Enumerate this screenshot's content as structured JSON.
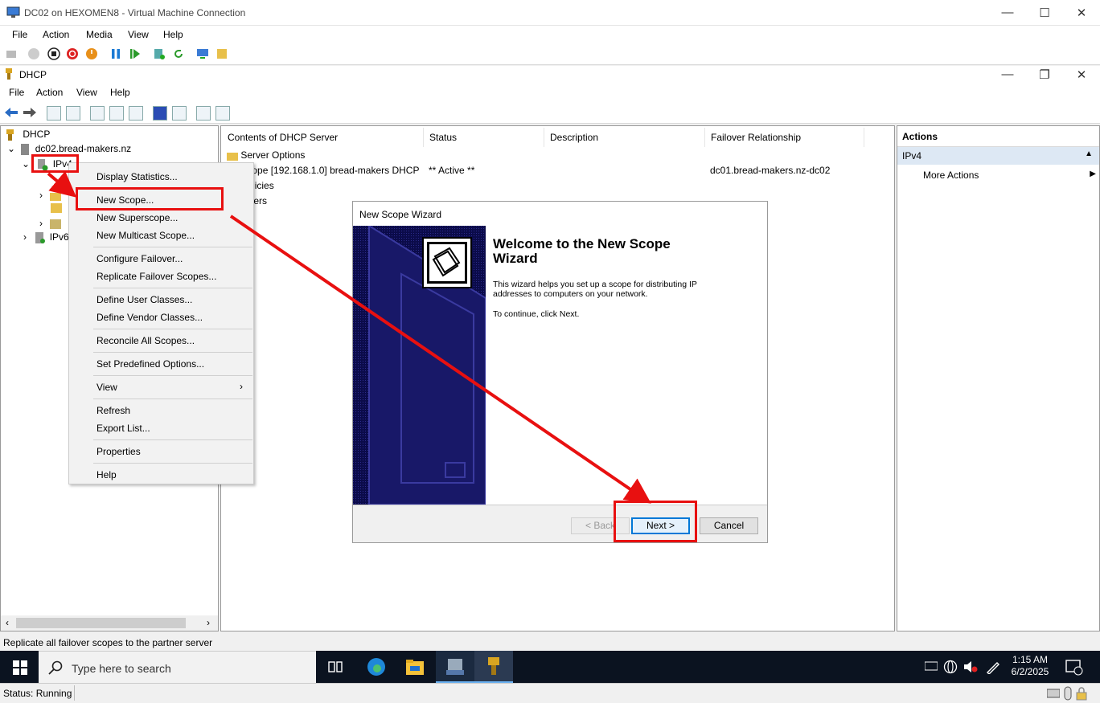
{
  "vm_window": {
    "title": "DC02 on HEXOMEN8 - Virtual Machine Connection",
    "menu": [
      "File",
      "Action",
      "Media",
      "View",
      "Help"
    ]
  },
  "dhcp_window": {
    "title": "DHCP",
    "menu": [
      "File",
      "Action",
      "View",
      "Help"
    ]
  },
  "tree": {
    "root": "DHCP",
    "server": "dc02.bread-makers.nz",
    "ipv4": "IPv4",
    "ipv6": "IPv6"
  },
  "content": {
    "columns": [
      "Contents of DHCP Server",
      "Status",
      "Description",
      "Failover Relationship"
    ],
    "rows": [
      {
        "name": "Server Options",
        "status": "",
        "description": "",
        "failover": ""
      },
      {
        "name": "Scope [192.168.1.0] bread-makers DHCP",
        "status": "** Active **",
        "description": "",
        "failover": "dc01.bread-makers.nz-dc02"
      },
      {
        "name": "Policies",
        "status": "",
        "description": "",
        "failover": ""
      },
      {
        "name": "Filters",
        "status": "",
        "description": "",
        "failover": ""
      }
    ]
  },
  "actions": {
    "header": "Actions",
    "section": "IPv4",
    "more": "More Actions"
  },
  "context_menu": {
    "items": [
      "Display Statistics...",
      "New Scope...",
      "New Superscope...",
      "New Multicast Scope...",
      "Configure Failover...",
      "Replicate Failover Scopes...",
      "Define User Classes...",
      "Define Vendor Classes...",
      "Reconcile All Scopes...",
      "Set Predefined Options...",
      "View",
      "Refresh",
      "Export List...",
      "Properties",
      "Help"
    ]
  },
  "wizard": {
    "title": "New Scope Wizard",
    "heading": "Welcome to the New Scope Wizard",
    "body": "This wizard helps you set up a scope for distributing IP addresses to computers on your network.",
    "continue": "To continue, click Next.",
    "back": "< Back",
    "next": "Next >",
    "cancel": "Cancel"
  },
  "dhcp_status": "Replicate all failover scopes to the partner server",
  "taskbar": {
    "search_placeholder": "Type here to search",
    "time": "1:15 AM",
    "date": "6/2/2025"
  },
  "vm_status": "Status: Running",
  "colors": {
    "annotation_red": "#e81010",
    "wizard_side": "#0b0b4a",
    "taskbar": "#0b1320"
  }
}
